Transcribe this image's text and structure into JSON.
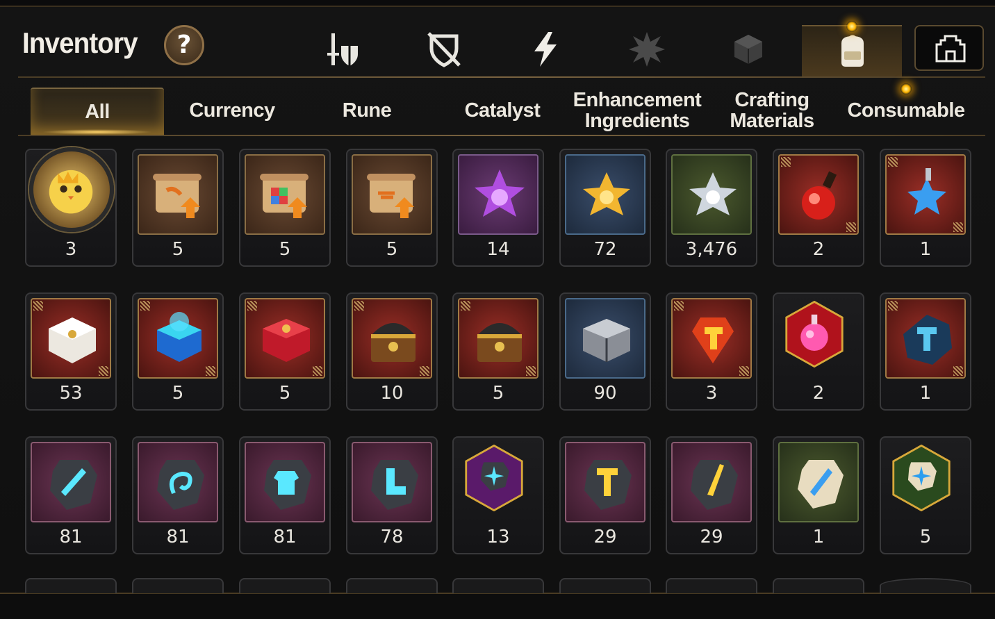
{
  "header": {
    "title": "Inventory",
    "help_label": "?",
    "categories": [
      {
        "icon": "sword-shield-icon",
        "active": false
      },
      {
        "icon": "broken-shield-icon",
        "active": false
      },
      {
        "icon": "lightning-icon",
        "active": false
      },
      {
        "icon": "artifact-burst-icon",
        "active": false
      },
      {
        "icon": "cube-icon",
        "active": false
      },
      {
        "icon": "backpack-icon",
        "active": true
      }
    ],
    "guild_icon": "guild-castle-icon"
  },
  "tabs": [
    {
      "label": "All",
      "active": true
    },
    {
      "label": "Currency"
    },
    {
      "label": "Rune"
    },
    {
      "label": "Catalyst"
    },
    {
      "label": "Enhancement Ingredients"
    },
    {
      "label": "Crafting Materials"
    },
    {
      "label": "Consumable"
    }
  ],
  "items": [
    [
      {
        "icon": "chick-mascot-icon",
        "count": "3"
      },
      {
        "icon": "scroll-upgrade-icon",
        "count": "5"
      },
      {
        "icon": "scroll-rainbow-cube-icon",
        "count": "5"
      },
      {
        "icon": "scroll-upgrade-icon",
        "count": "5"
      },
      {
        "icon": "purple-crystal-flower-icon",
        "count": "14"
      },
      {
        "icon": "gold-crystal-flower-icon",
        "count": "72"
      },
      {
        "icon": "silver-crystal-flower-icon",
        "count": "3,476"
      },
      {
        "icon": "red-potion-icon",
        "count": "2"
      },
      {
        "icon": "blue-star-potion-icon",
        "count": "1"
      }
    ],
    [
      {
        "icon": "white-gold-chest-icon",
        "count": "53"
      },
      {
        "icon": "blue-chest-icon",
        "count": "5"
      },
      {
        "icon": "red-chest-icon",
        "count": "5"
      },
      {
        "icon": "gold-treasure-chest-icon",
        "count": "10"
      },
      {
        "icon": "gold-treasure-chest-icon",
        "count": "5"
      },
      {
        "icon": "silver-chest-icon",
        "count": "90"
      },
      {
        "icon": "red-hammer-gem-icon",
        "count": "3"
      },
      {
        "icon": "pink-potion-icon",
        "count": "2"
      },
      {
        "icon": "blue-hammer-stone-icon",
        "count": "1"
      }
    ],
    [
      {
        "icon": "sword-rune-icon",
        "count": "81"
      },
      {
        "icon": "spiral-rune-icon",
        "count": "81"
      },
      {
        "icon": "armor-rune-icon",
        "count": "81"
      },
      {
        "icon": "boot-rune-icon",
        "count": "78"
      },
      {
        "icon": "star-rune-icon",
        "count": "13"
      },
      {
        "icon": "hammer-rune-icon",
        "count": "29"
      },
      {
        "icon": "blade-rune-icon",
        "count": "29"
      },
      {
        "icon": "stone-sword-rune-icon",
        "count": "1"
      },
      {
        "icon": "stone-star-rune-icon",
        "count": "5"
      }
    ]
  ],
  "colors": {
    "accent_gold": "#b8925a",
    "notification": "#ffb400"
  }
}
